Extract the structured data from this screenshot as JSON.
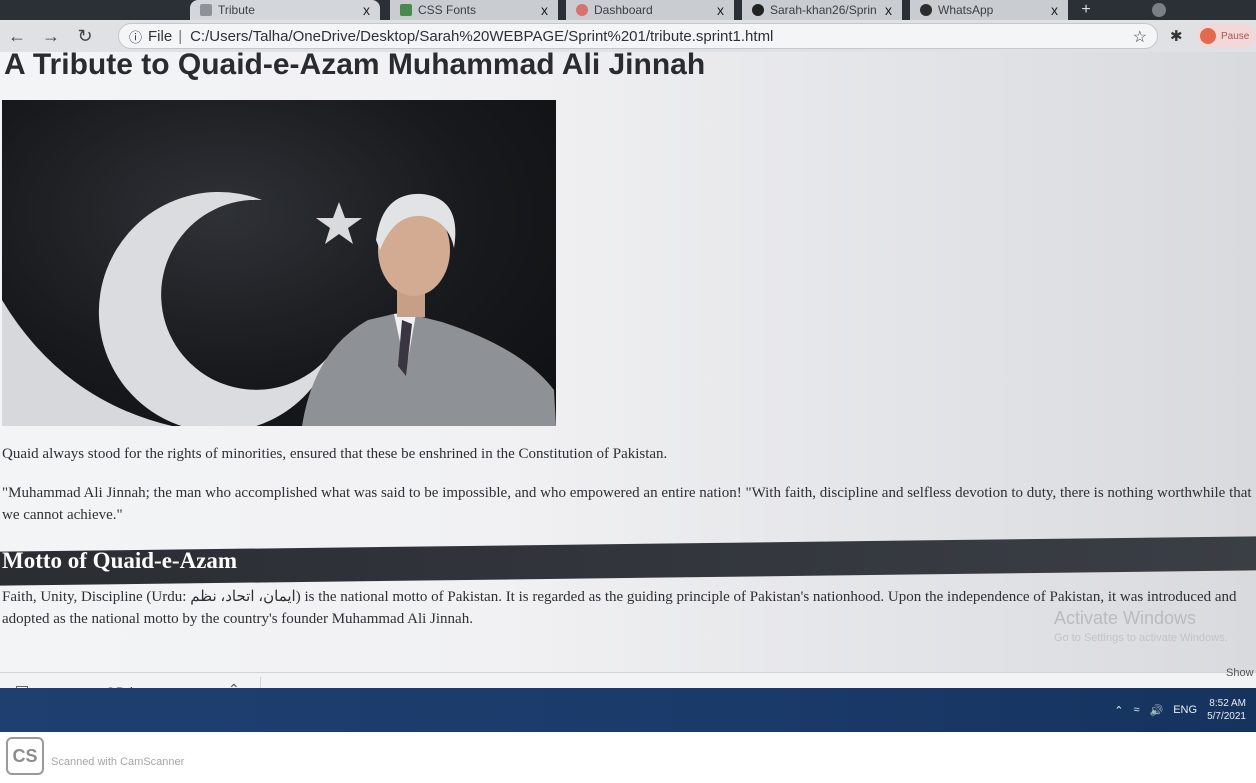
{
  "browser": {
    "tabs": [
      {
        "label": "Tribute",
        "active": true
      },
      {
        "label": "CSS Fonts"
      },
      {
        "label": "Dashboard"
      },
      {
        "label": "Sarah-khan26/Sprin"
      },
      {
        "label": "WhatsApp"
      }
    ],
    "new_tab_label": "+",
    "close_symbol": "x",
    "file_label": "File",
    "url": "C:/Users/Talha/OneDrive/Desktop/Sarah%20WEBPAGE/Sprint%201/tribute.sprint1.html",
    "profile_label": "Pause",
    "icons": [
      "back-icon",
      "forward-icon",
      "reload-icon",
      "info-icon",
      "star-icon",
      "puzzle-icon"
    ]
  },
  "page": {
    "title": "A Tribute to Quaid-e-Azam Muhammad Ali Jinnah",
    "image_alt": "Portrait of Quaid-e-Azam with crescent and star",
    "paragraph1": "Quaid always stood for the rights of minorities, ensured that these be enshrined in the Constitution of Pakistan.",
    "paragraph2": "\"Muhammad Ali Jinnah; the man who accomplished what was said to be impossible, and who empowered an entire nation! \"With faith, discipline and selfless devotion to duty, there is nothing worthwhile that we cannot achieve.\"",
    "motto_heading": "Motto of Quaid-e-Azam",
    "motto_paragraph": "Faith, Unity, Discipline (Urdu: ایمان، اتحاد، نظم) is the national motto of Pakistan. It is regarded as the guiding principle of Pakistan's nationhood. Upon the independence of Pakistan, it was introduced and adopted as the national motto by the country's founder Muhammad Ali Jinnah."
  },
  "watermark": {
    "title": "Activate Windows",
    "subtitle": "Go to Settings to activate Windows."
  },
  "downloads": {
    "file_name": "QD.jpg",
    "show_all": "Show"
  },
  "taskbar": {
    "language": "ENG",
    "time": "8:52 AM",
    "date": "5/7/2021"
  },
  "scanner": {
    "logo": "CS",
    "text": "Scanned with CamScanner"
  },
  "colors": {
    "page_bg": "#f2f3f5",
    "heading_bar": "#2f3238",
    "taskbar": "#1e3f70"
  }
}
